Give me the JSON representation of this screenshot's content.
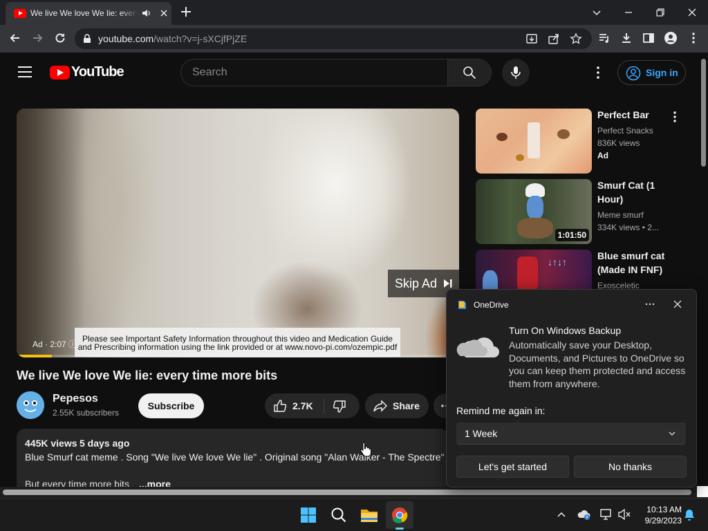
{
  "browser": {
    "tab_title": "We live We love We lie: every time more bits",
    "url_domain": "youtube.com",
    "url_path": "/watch?v=j-sXCjfPjZE"
  },
  "youtube": {
    "logo_text": "YouTube",
    "search_placeholder": "Search",
    "signin_label": "Sign in",
    "player": {
      "skip_label": "Skip Ad",
      "ad_info": "Ad · 2:07",
      "notice_line1": "Please see Important Safety Information throughout this video and Medication Guide",
      "notice_line2": "and Prescribing information using the link provided or at www.novo-pi.com/ozempic.pdf",
      "ad_progress": 0.08
    },
    "video_title": "We live We love We lie: every time more bits",
    "channel_name": "Pepesos",
    "subscribers": "2.55K subscribers",
    "subscribe_label": "Subscribe",
    "likes": "2.7K",
    "share_label": "Share",
    "description": {
      "views": "445K views",
      "date": "5 days ago",
      "line1": "Blue Smurf cat meme . Song \"We live We love We lie\" . Original song \"Alan Walker - The Spectre\"",
      "line2": "But every time more bits",
      "more_label": "...more"
    },
    "sidebar": [
      {
        "title": "Perfect Bar",
        "meta1": "Perfect Snacks",
        "meta2": "836K views",
        "meta3": "Ad"
      },
      {
        "title": "Smurf Cat (1 Hour)",
        "meta1": "Meme smurf",
        "meta2": "334K views  • 2...",
        "duration": "1:01:50"
      },
      {
        "title": "Blue smurf cat (Made IN FNF)",
        "meta1": "Exosceletic"
      }
    ]
  },
  "onedrive": {
    "app_name": "OneDrive",
    "heading": "Turn On Windows Backup",
    "body": "Automatically save your Desktop, Documents, and Pictures to OneDrive so you can keep them protected and access them from anywhere.",
    "remind_label": "Remind me again in:",
    "remind_value": "1 Week",
    "primary_button": "Let's get started",
    "secondary_button": "No thanks"
  },
  "taskbar": {
    "time": "10:13 AM",
    "date": "9/29/2023"
  }
}
